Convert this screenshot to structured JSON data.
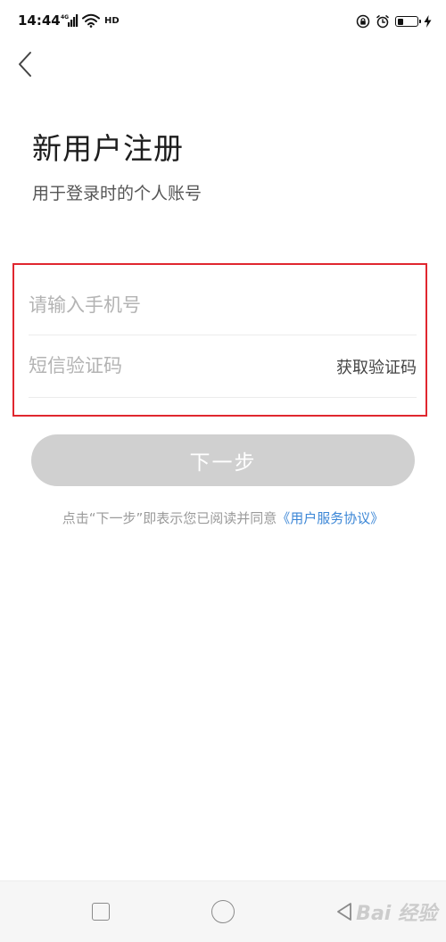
{
  "status_bar": {
    "time": "14:44",
    "network_label": "4G",
    "hd_label": "HD"
  },
  "header": {
    "title": "新用户注册",
    "subtitle": "用于登录时的个人账号"
  },
  "form": {
    "phone_placeholder": "请输入手机号",
    "phone_value": "",
    "code_placeholder": "短信验证码",
    "code_value": "",
    "get_code_label": "获取验证码"
  },
  "actions": {
    "next_label": "下一步"
  },
  "agreement": {
    "prefix": "点击“下一步”即表示您已阅读并同意",
    "link": "《用户服务协议》"
  },
  "watermark": "Bai 经验",
  "battery": {
    "level": 0.35
  },
  "colors": {
    "highlight": "#e0272f",
    "link": "#3b86d6",
    "disabled_button": "#d0d0d0"
  }
}
